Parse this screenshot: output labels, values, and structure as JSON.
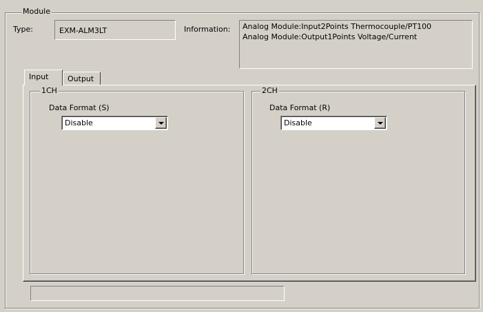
{
  "module": {
    "legend": "Module",
    "type_label": "Type:",
    "type_value": "EXM-ALM3LT",
    "info_label": "Information:",
    "info_lines": [
      "Analog Module:Input2Points Thermocouple/PT100",
      "Analog Module:Output1Points Voltage/Current"
    ]
  },
  "tabs": [
    {
      "label": "Input",
      "active": true
    },
    {
      "label": "Output",
      "active": false
    }
  ],
  "channels": [
    {
      "legend": "1CH",
      "format_label": "Data Format (S)",
      "format_value": "Disable"
    },
    {
      "legend": "2CH",
      "format_label": "Data Format (R)",
      "format_value": "Disable"
    }
  ],
  "status": {
    "text": ""
  },
  "icons": {
    "dropdown": "chevron-down-icon"
  }
}
